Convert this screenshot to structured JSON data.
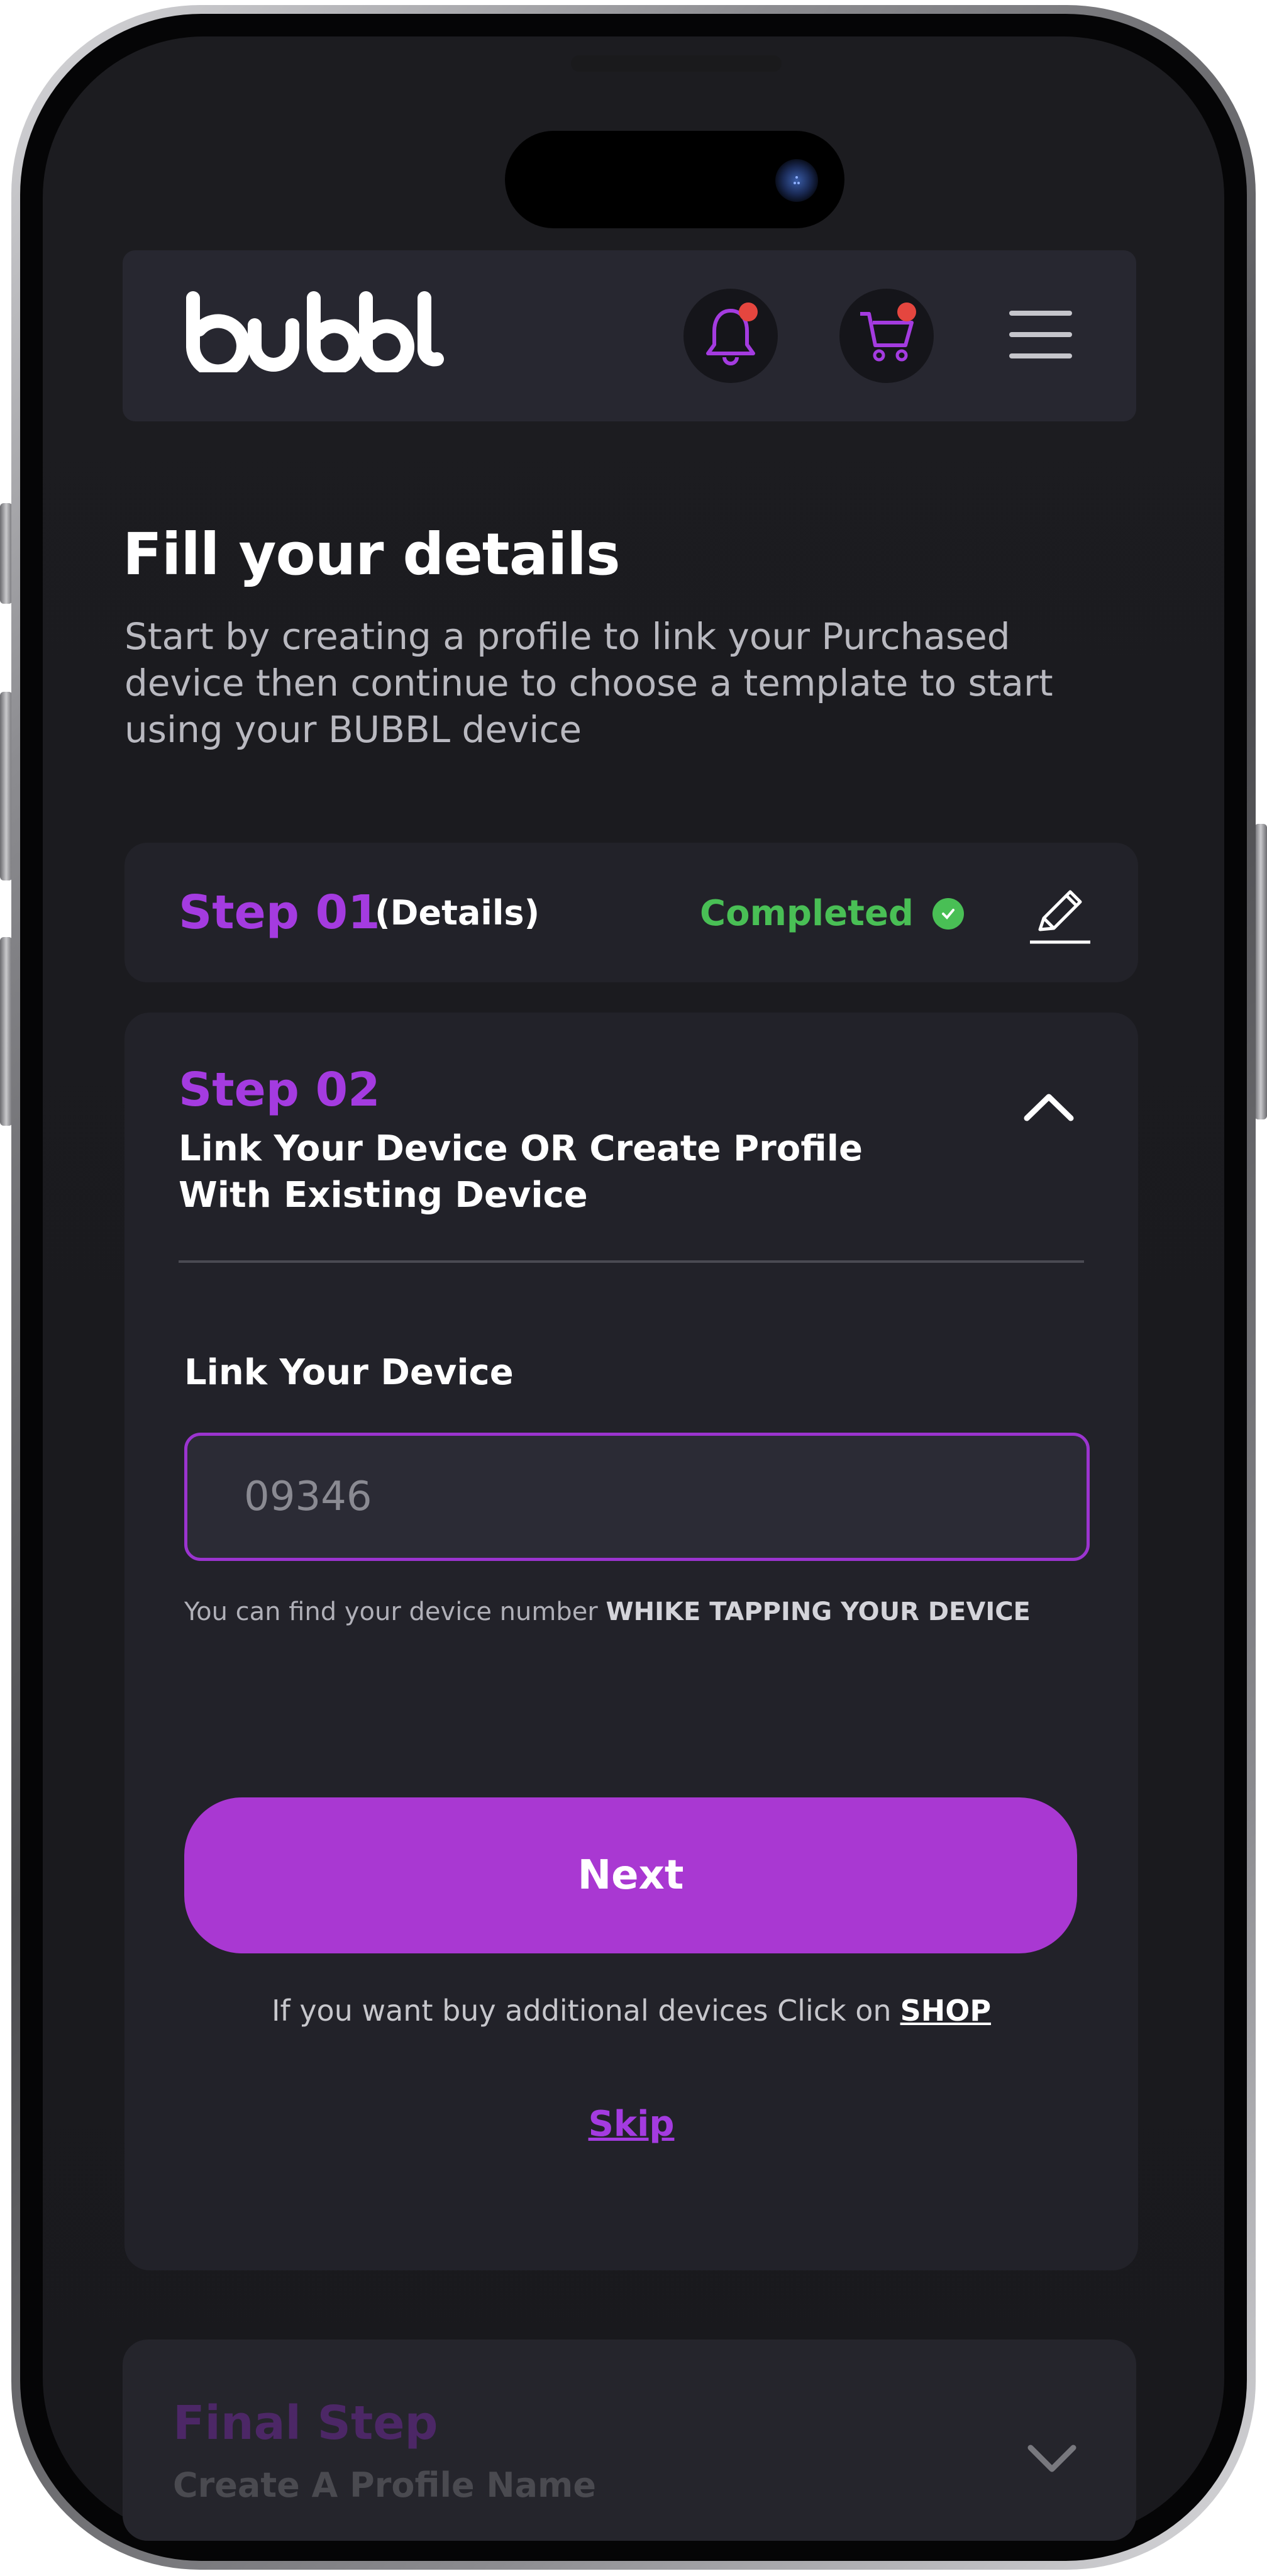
{
  "app": {
    "logo_text": "bubbl",
    "brand_color": "#a43be0",
    "notification_icon": "bell-icon",
    "cart_icon": "cart-icon",
    "menu_icon": "hamburger-menu-icon"
  },
  "page": {
    "title": "Fill your details",
    "intro": "Start by creating a profile to link your Purchased device then continue to choose a template to  start using your BUBBL device"
  },
  "step1": {
    "number": "Step 01",
    "subtitle": "(Details)",
    "status": "Completed",
    "status_color": "#49bf55",
    "edit_icon": "pencil-icon"
  },
  "step2": {
    "number": "Step 02",
    "title": "Link Your Device OR Create Profile With Existing Device",
    "collapse_icon": "chevron-up-icon",
    "field_label": "Link Your Device",
    "device_number_placeholder": "09346",
    "hint_prefix": "You can find your device number ",
    "hint_strong": "WHIKE TAPPING YOUR DEVICE",
    "next_label": "Next",
    "shop_prefix": "If you want buy additional devices Click on",
    "shop_link": "SHOP",
    "skip_label": "Skip"
  },
  "final_step": {
    "title": "Final Step",
    "subtitle": "Create A Profile Name",
    "expand_icon": "chevron-down-icon"
  }
}
